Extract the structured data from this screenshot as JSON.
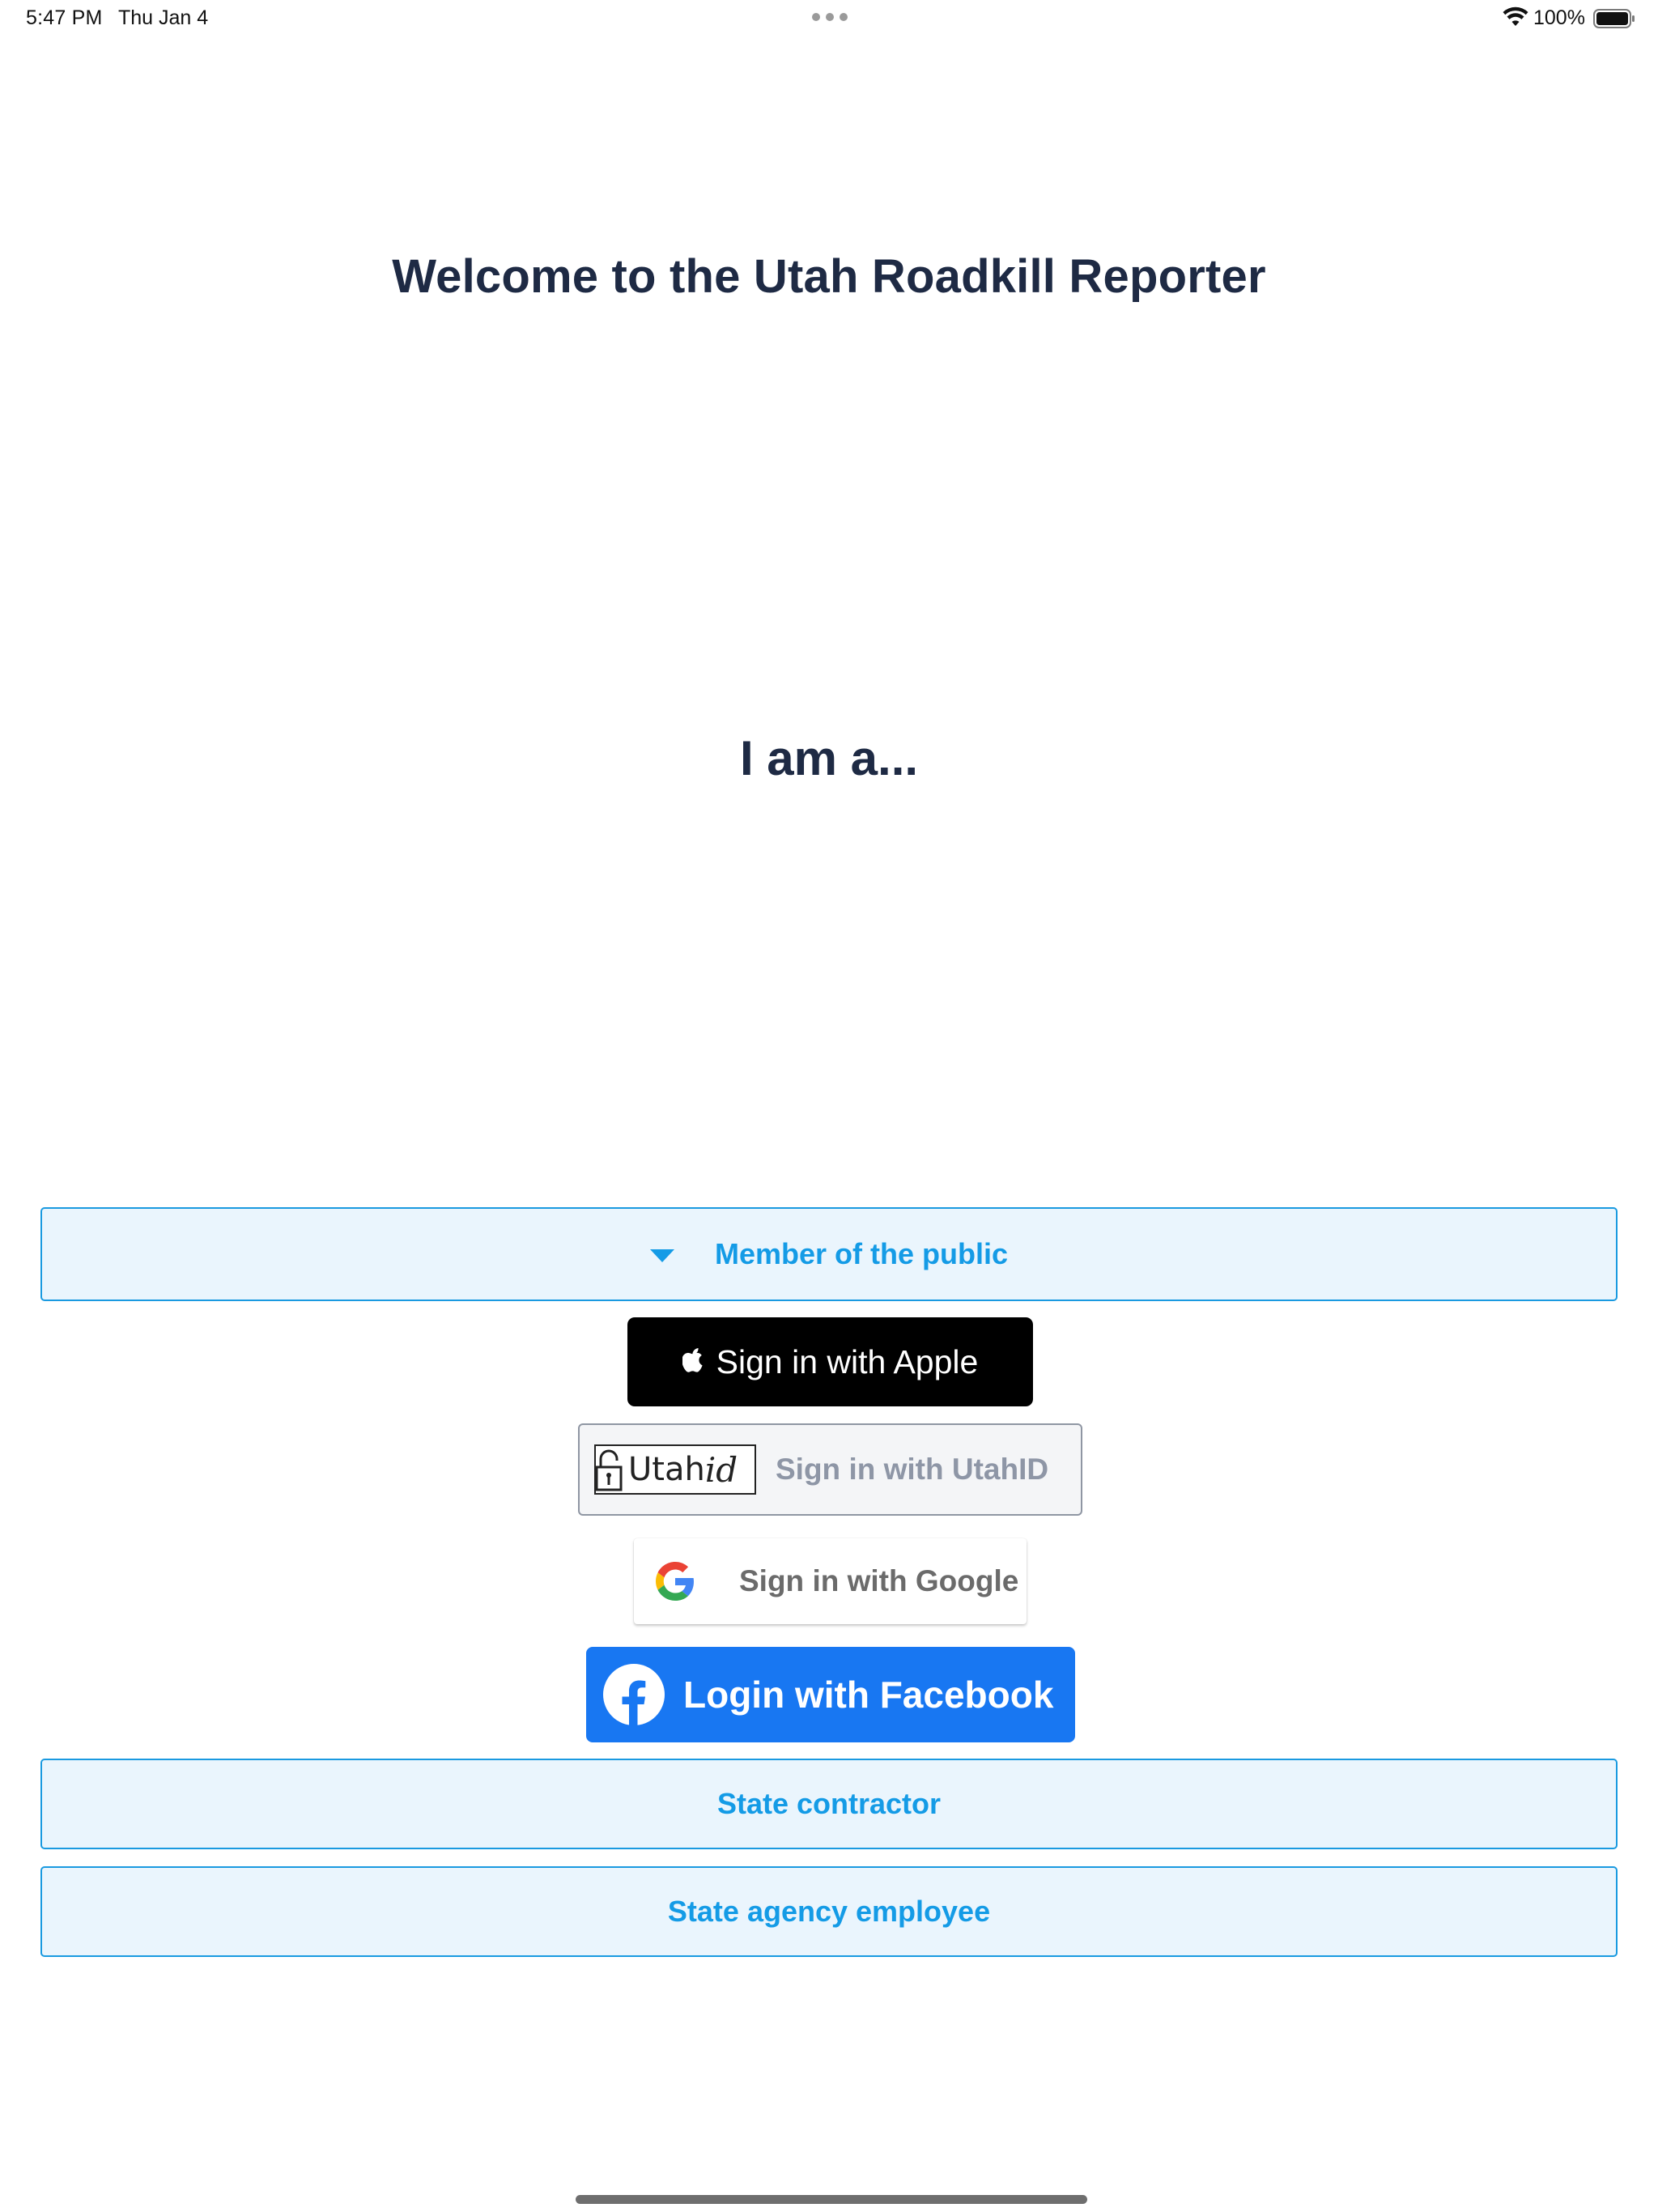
{
  "status_bar": {
    "time": "5:47 PM",
    "date": "Thu Jan 4",
    "battery_percent": "100%",
    "icons": [
      "multitask-dots-icon",
      "wifi-icon",
      "battery-icon"
    ]
  },
  "welcome": {
    "title": "Welcome to the Utah Roadkill Reporter",
    "prompt": "I am a..."
  },
  "roles": {
    "public_label": "Member of the public",
    "public_expanded": true,
    "contractor_label": "State contractor",
    "employee_label": "State agency employee"
  },
  "sign_in": {
    "apple_label": "Sign in with Apple",
    "utahid_logo_utah": "Utah",
    "utahid_logo_id": "id",
    "utahid_label": "Sign in with UtahID",
    "google_label": "Sign in with Google",
    "facebook_label": "Login with Facebook"
  },
  "colors": {
    "heading": "#1e2a44",
    "role_border": "#1a9ae0",
    "role_background": "#eaf5fd",
    "role_text": "#149be6",
    "apple": "#000000",
    "facebook": "#1877f2",
    "utahid_text": "#8e96a6"
  }
}
